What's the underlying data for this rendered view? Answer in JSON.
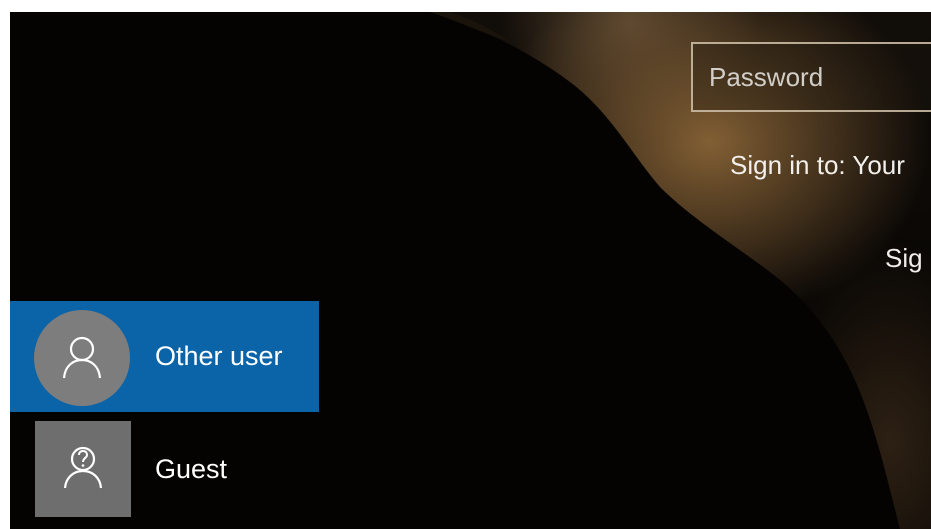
{
  "login": {
    "password_placeholder": "Password",
    "sign_in_to": "Sign in to: Your",
    "sign_in_options": "Sig"
  },
  "users": [
    {
      "label": "Other user",
      "icon": "person-icon",
      "selected": true
    },
    {
      "label": "Guest",
      "icon": "guest-icon",
      "selected": false
    }
  ],
  "colors": {
    "selected_user_bg": "#0b63a8",
    "avatar_circle_bg": "#7d7d7d",
    "avatar_square_bg": "#6e6e6e",
    "background": "#080604"
  }
}
